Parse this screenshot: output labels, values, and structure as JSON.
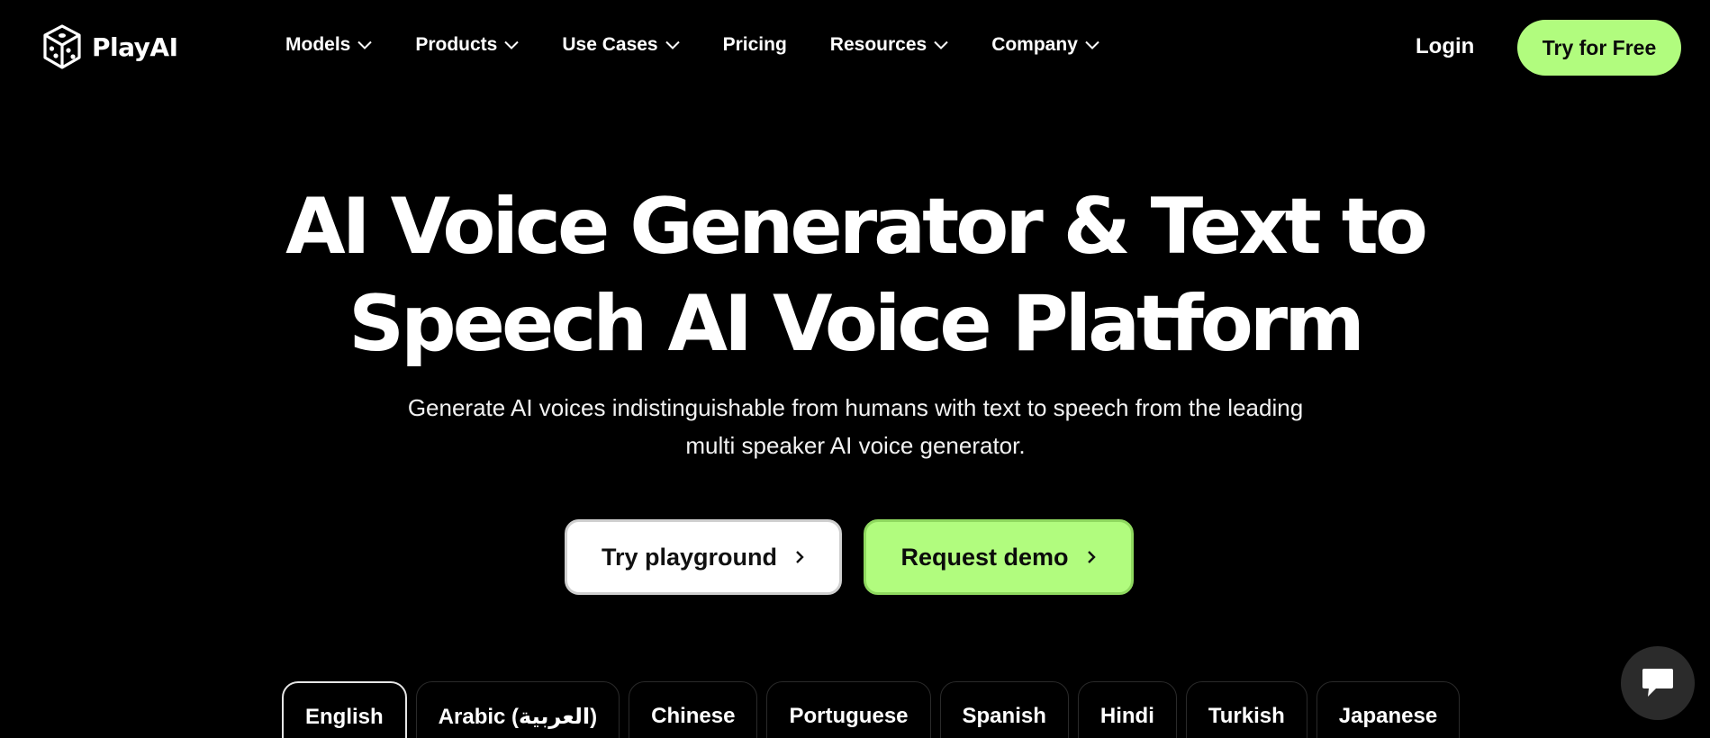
{
  "brand": {
    "name": "PlayAI",
    "icon": "dice-cube-icon"
  },
  "nav": {
    "items": [
      {
        "label": "Models",
        "has_dropdown": true
      },
      {
        "label": "Products",
        "has_dropdown": true
      },
      {
        "label": "Use Cases",
        "has_dropdown": true
      },
      {
        "label": "Pricing",
        "has_dropdown": false
      },
      {
        "label": "Resources",
        "has_dropdown": true
      },
      {
        "label": "Company",
        "has_dropdown": true
      }
    ],
    "login_label": "Login",
    "try_free_label": "Try for Free"
  },
  "hero": {
    "title_line1": "AI Voice Generator & Text to",
    "title_line2": "Speech AI Voice Platform",
    "subtitle_line1": "Generate AI voices indistinguishable from humans with text to speech from the leading",
    "subtitle_line2": "multi speaker AI voice generator.",
    "cta_playground": "Try playground",
    "cta_demo": "Request demo"
  },
  "languages": {
    "tabs": [
      "English",
      "Arabic (العربية)",
      "Chinese",
      "Portuguese",
      "Spanish",
      "Hindi",
      "Turkish",
      "Japanese"
    ],
    "selected": "English"
  },
  "chat": {
    "icon": "chat-bubble-icon"
  },
  "colors": {
    "background": "#000000",
    "accent": "#b1fc7e",
    "text": "#ffffff"
  }
}
